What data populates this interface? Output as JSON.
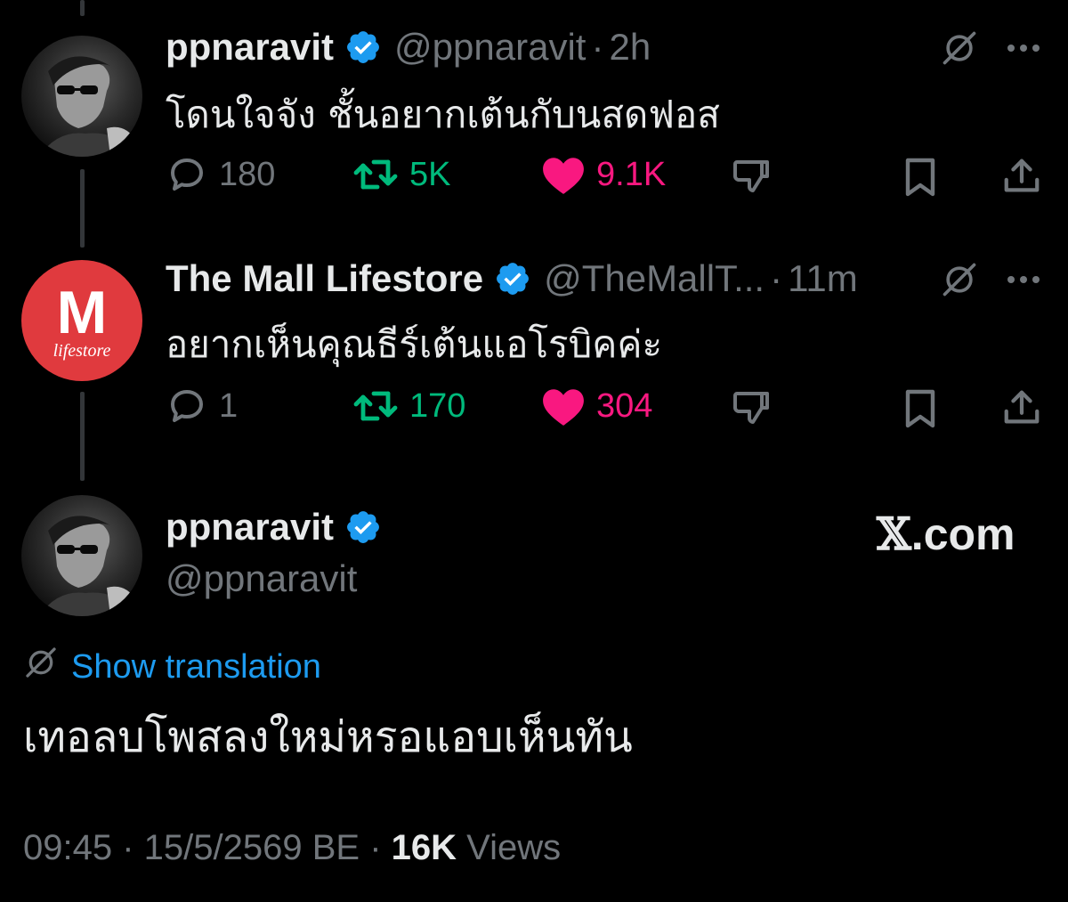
{
  "tweets": [
    {
      "display_name": "ppnaravit",
      "handle": "@ppnaravit",
      "separator": "·",
      "time": "2h",
      "text": "โดนใจจัง ชั้นอยากเต้นกับนสดฟอส",
      "replies": "180",
      "retweets": "5K",
      "likes": "9.1K"
    },
    {
      "display_name": "The Mall Lifestore",
      "handle": "@TheMallT...",
      "separator": "·",
      "time": "11m",
      "text": "อยากเห็นคุณธีร์เต้นแอโรบิคค่ะ",
      "replies": "1",
      "retweets": "170",
      "likes": "304",
      "avatar_letter": "M",
      "avatar_sub": "lifestore"
    }
  ],
  "main_tweet": {
    "display_name": "ppnaravit",
    "handle": "@ppnaravit",
    "brand_x": "𝕏",
    "brand_rest": ".com",
    "translation_label": "Show translation",
    "text": "เทอลบโพสลงใหม่หรอแอบเห็นทัน",
    "time": "09:45",
    "dot1": " · ",
    "date": "15/5/2569 BE",
    "dot2": " · ",
    "views_count": "16K",
    "views_label": " Views"
  },
  "icons": {
    "verified": "verified-badge-icon",
    "grok": "grok-icon",
    "more": "more-icon",
    "reply": "reply-icon",
    "retweet": "retweet-icon",
    "like": "heart-icon",
    "dislike": "dislike-icon",
    "bookmark": "bookmark-icon",
    "share": "share-icon",
    "translate": "translate-icon"
  },
  "colors": {
    "background": "#000000",
    "text": "#e7e9ea",
    "muted": "#71767b",
    "accent_blue": "#1d9bf0",
    "retweet_green": "#00ba7c",
    "like_pink": "#f91880",
    "mall_red": "#e03a3e"
  }
}
